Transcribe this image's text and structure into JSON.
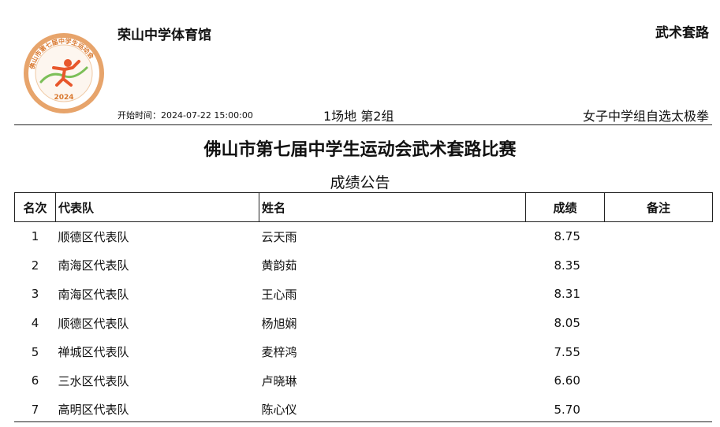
{
  "header": {
    "venue": "荣山中学体育馆",
    "event_type": "武术套路",
    "start_time": "开始时间：2024-07-22 15:00:00",
    "venue_group": "1场地 第2组",
    "category": "女子中学组自选太极拳"
  },
  "logo": {
    "ring_text": "佛山市第七届中学生运动会",
    "year": "2024",
    "ring_color": "#e7a46b",
    "accent_color": "#7cbf58",
    "figure_color": "#e8572c"
  },
  "title": "佛山市第七届中学生运动会武术套路比赛",
  "subtitle": "成绩公告",
  "table": {
    "headers": {
      "rank": "名次",
      "team": "代表队",
      "name": "姓名",
      "score": "成绩",
      "remark": "备注"
    },
    "rows": [
      {
        "rank": "1",
        "team": "顺德区代表队",
        "name": "云天雨",
        "score": "8.75",
        "remark": ""
      },
      {
        "rank": "2",
        "team": "南海区代表队",
        "name": "黄韵茹",
        "score": "8.35",
        "remark": ""
      },
      {
        "rank": "3",
        "team": "南海区代表队",
        "name": "王心雨",
        "score": "8.31",
        "remark": ""
      },
      {
        "rank": "4",
        "team": "顺德区代表队",
        "name": "杨旭娴",
        "score": "8.05",
        "remark": ""
      },
      {
        "rank": "5",
        "team": "禅城区代表队",
        "name": "麦梓鸿",
        "score": "7.55",
        "remark": ""
      },
      {
        "rank": "6",
        "team": "三水区代表队",
        "name": "卢晓琳",
        "score": "6.60",
        "remark": ""
      },
      {
        "rank": "7",
        "team": "高明区代表队",
        "name": "陈心仪",
        "score": "5.70",
        "remark": ""
      }
    ]
  }
}
